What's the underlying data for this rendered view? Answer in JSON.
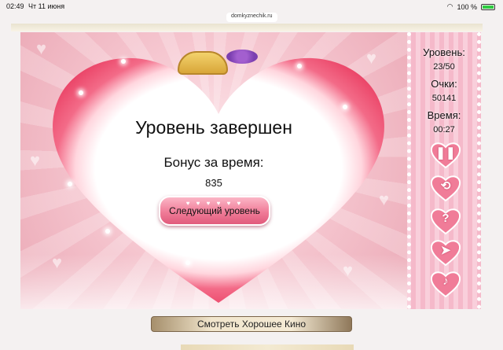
{
  "statusbar": {
    "time": "02:49",
    "date": "Чт 11 июня",
    "battery": "100 %"
  },
  "browser": {
    "url": "domkyznechik.ru"
  },
  "dialog": {
    "title": "Уровень завершен",
    "bonus_label": "Бонус за время:",
    "bonus_value": "835",
    "next_button": "Следующий уровень"
  },
  "sidebar": {
    "level_label": "Уровень:",
    "level_value": "23/50",
    "score_label": "Очки:",
    "score_value": "50141",
    "time_label": "Время:",
    "time_value": "00:27",
    "buttons": [
      {
        "icon": "pause-icon",
        "glyph": "❚❚"
      },
      {
        "icon": "restart-icon",
        "glyph": "⟲"
      },
      {
        "icon": "help-icon",
        "glyph": "?"
      },
      {
        "icon": "walkthrough-icon",
        "glyph": "➤"
      },
      {
        "icon": "music-icon",
        "glyph": "♪"
      }
    ]
  },
  "footer": {
    "watch_button": "Смотреть Хорошее Кино"
  },
  "colors": {
    "heart_frame": "#f04a6c",
    "panel": "#f7c2d1",
    "button": "#f07c98"
  }
}
